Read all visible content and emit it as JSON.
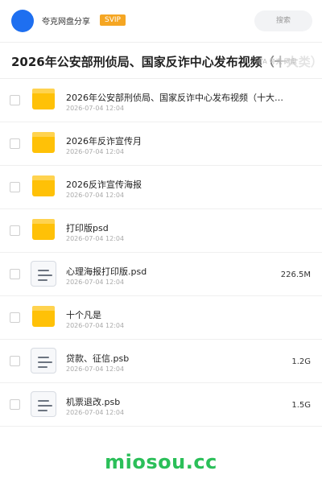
{
  "header": {
    "app_name": "夸克网盘分享",
    "badge": "SVIP",
    "search_placeholder": "搜索"
  },
  "title": {
    "text": "2026年公安部刑侦局、国家反诈中心发布视频（十大类）",
    "ghost_text": "TA 夸克 网盘"
  },
  "files": [
    {
      "name": "2026年公安部刑侦局、国家反诈中心发布视频（十大…",
      "date": "2026-07-04 12:04",
      "type": "folder",
      "size": ""
    },
    {
      "name": "2026年反诈宣传月",
      "date": "2026-07-04 12:04",
      "type": "folder",
      "size": ""
    },
    {
      "name": "2026反诈宣传海报",
      "date": "2026-07-04 12:04",
      "type": "folder",
      "size": ""
    },
    {
      "name": "打印版psd",
      "date": "2026-07-04 12:04",
      "type": "folder",
      "size": ""
    },
    {
      "name": "心理海报打印版.psd",
      "date": "2026-07-04 12:04",
      "type": "file",
      "size": "226.5M"
    },
    {
      "name": "十个凡是",
      "date": "2026-07-04 12:04",
      "type": "folder",
      "size": ""
    },
    {
      "name": "贷款、征信.psb",
      "date": "2026-07-04 12:04",
      "type": "file",
      "size": "1.2G"
    },
    {
      "name": "机票退改.psb",
      "date": "2026-07-04 12:04",
      "type": "file",
      "size": "1.5G"
    }
  ],
  "watermark": "miosou.cc",
  "colors": {
    "avatar": "#1e6ff0",
    "badge": "#f5a623",
    "folder": "#ffc107",
    "watermark": "#2bbf59"
  }
}
